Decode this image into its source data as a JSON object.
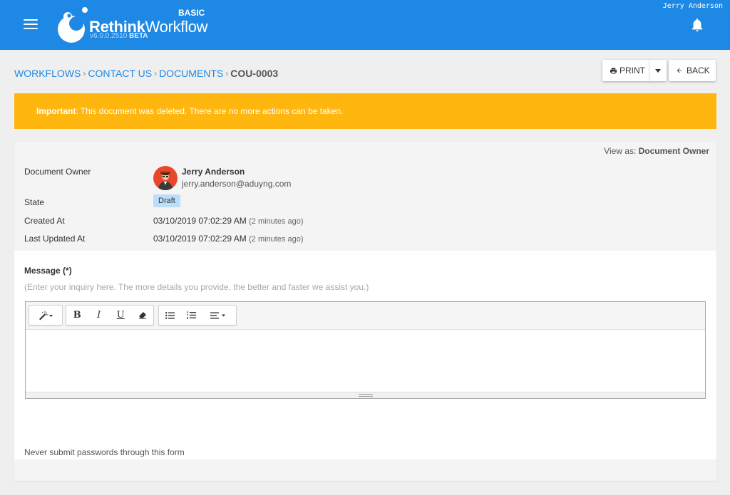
{
  "header": {
    "brand_bold": "Rethink",
    "brand_light": "Workflow",
    "edition": "BASIC",
    "version": "v6.0.0.2510",
    "version_tag": "BETA",
    "username": "Jerry Anderson",
    "bg_color": "#1e88e5"
  },
  "breadcrumb": {
    "items": [
      "WORKFLOWS",
      "CONTACT US",
      "DOCUMENTS"
    ],
    "current": "COU-0003"
  },
  "toolbar": {
    "print_label": "PRINT",
    "back_label": "BACK"
  },
  "alert": {
    "strong": "Important",
    "message": ": This document was deleted. There are no more actions can be taken.",
    "color": "#ffb60f"
  },
  "document": {
    "view_as_label": "View as:",
    "view_as_value": "Document Owner",
    "owner_label": "Document Owner",
    "owner_name": "Jerry Anderson",
    "owner_email": "jerry.anderson@aduyng.com",
    "state_label": "State",
    "state_value": "Draft",
    "created_label": "Created At",
    "created_value": "03/10/2019 07:02:29 AM",
    "created_ago": "(2 minutes ago)",
    "updated_label": "Last Updated At",
    "updated_value": "03/10/2019 07:02:29 AM",
    "updated_ago": "(2 minutes ago)"
  },
  "form": {
    "message_label": "Message (*)",
    "message_help": "(Enter your inquiry here. The more details you provide, the better and faster we assist you.)",
    "editor_icons": [
      "magic-wand-icon",
      "bold-icon",
      "italic-icon",
      "underline-icon",
      "eraser-icon",
      "bullet-list-icon",
      "numbered-list-icon",
      "align-icon"
    ],
    "note": "Never submit passwords through this form"
  }
}
